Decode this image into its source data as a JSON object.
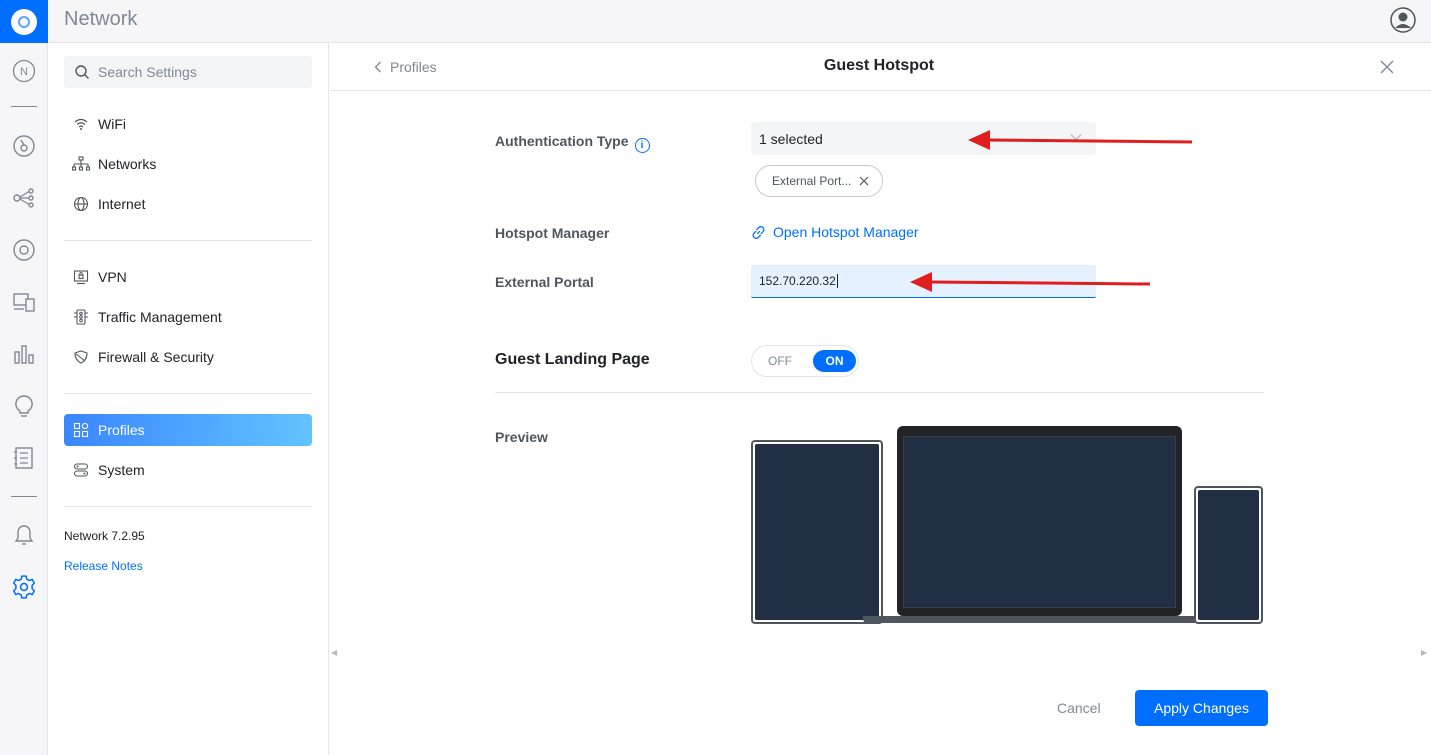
{
  "app": {
    "title": "Network"
  },
  "search": {
    "placeholder": "Search Settings"
  },
  "nav": {
    "items": [
      {
        "label": "WiFi",
        "icon": "wifi-icon"
      },
      {
        "label": "Networks",
        "icon": "networks-icon"
      },
      {
        "label": "Internet",
        "icon": "globe-icon"
      },
      {
        "label": "VPN",
        "icon": "vpn-icon"
      },
      {
        "label": "Traffic Management",
        "icon": "traffic-icon"
      },
      {
        "label": "Firewall & Security",
        "icon": "shield-icon"
      },
      {
        "label": "Profiles",
        "icon": "profiles-icon",
        "active": true
      },
      {
        "label": "System",
        "icon": "system-icon"
      }
    ],
    "version": "Network 7.2.95",
    "release_notes": "Release Notes"
  },
  "panel": {
    "back_label": "Profiles",
    "title": "Guest Hotspot",
    "auth_type_label": "Authentication Type",
    "auth_type_value": "1 selected",
    "auth_chip": "External Port...",
    "hotspot_manager_label": "Hotspot Manager",
    "hotspot_manager_link": "Open Hotspot Manager",
    "external_portal_label": "External Portal",
    "external_portal_value": "152.70.220.32",
    "landing_page_label": "Guest Landing Page",
    "toggle_off": "OFF",
    "toggle_on": "ON",
    "landing_page_enabled": true,
    "preview_label": "Preview",
    "cancel_label": "Cancel",
    "apply_label": "Apply Changes"
  },
  "colors": {
    "accent": "#006fff",
    "annotation_arrow": "#e01e1e",
    "device_screen": "#212e44"
  }
}
